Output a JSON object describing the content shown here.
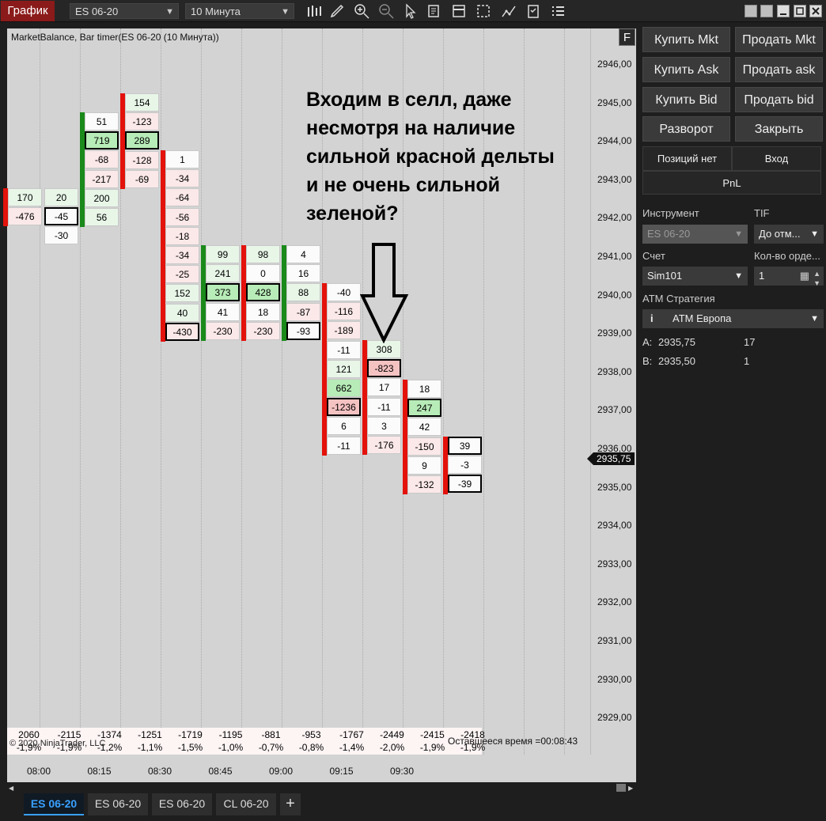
{
  "topbar": {
    "title": "График",
    "instrument": "ES 06-20",
    "interval": "10 Минута"
  },
  "chart": {
    "label": "MarketBalance, Bar timer(ES 06-20 (10 Минута))",
    "f_button": "F",
    "note": "Входим в селл, даже несмотря на наличие сильной красной дельты и не очень сильной зеленой?",
    "price_ticks": [
      "2946,00",
      "2945,00",
      "2944,00",
      "2943,00",
      "2942,00",
      "2941,00",
      "2940,00",
      "2939,00",
      "2938,00",
      "2937,00",
      "2936,00",
      "2935,00",
      "2934,00",
      "2933,00",
      "2932,00",
      "2931,00",
      "2930,00",
      "2929,00"
    ],
    "current_price": "2935,75",
    "time_ticks": [
      "08:00",
      "08:15",
      "08:30",
      "08:45",
      "09:00",
      "09:15",
      "09:30"
    ],
    "columns": [
      {
        "bar": "red",
        "cells": [
          {
            "v": "170",
            "c": "g"
          },
          {
            "v": "-476",
            "c": "r"
          }
        ]
      },
      {
        "bar": "",
        "cells": [
          {
            "v": "20",
            "c": "g"
          },
          {
            "v": "-45",
            "c": "b"
          },
          {
            "v": "-30",
            "c": ""
          }
        ]
      },
      {
        "bar": "green",
        "cells": [
          {
            "v": "51",
            "c": ""
          },
          {
            "v": "719",
            "c": "Gb"
          },
          {
            "v": "-68",
            "c": "r"
          },
          {
            "v": "-217",
            "c": "r"
          },
          {
            "v": "200",
            "c": "g"
          },
          {
            "v": "56",
            "c": "g"
          }
        ]
      },
      {
        "bar": "red",
        "cells": [
          {
            "v": "154",
            "c": "g"
          },
          {
            "v": "-123",
            "c": "r"
          },
          {
            "v": "289",
            "c": "Gb"
          },
          {
            "v": "-128",
            "c": "r"
          },
          {
            "v": "-69",
            "c": "r"
          }
        ]
      },
      {
        "bar": "red",
        "cells": [
          {
            "v": "1",
            "c": ""
          },
          {
            "v": "-34",
            "c": "r"
          },
          {
            "v": "-64",
            "c": "r"
          },
          {
            "v": "-56",
            "c": "r"
          },
          {
            "v": "-18",
            "c": "r"
          },
          {
            "v": "-34",
            "c": "r"
          },
          {
            "v": "-25",
            "c": "r"
          },
          {
            "v": "152",
            "c": "g"
          },
          {
            "v": "40",
            "c": "g"
          },
          {
            "v": "-430",
            "c": "rb"
          }
        ]
      },
      {
        "bar": "green",
        "cells": [
          {
            "v": "99",
            "c": "g"
          },
          {
            "v": "241",
            "c": "g"
          },
          {
            "v": "373",
            "c": "Gb"
          },
          {
            "v": "41",
            "c": ""
          },
          {
            "v": "-230",
            "c": "r"
          }
        ]
      },
      {
        "bar": "red",
        "cells": [
          {
            "v": "98",
            "c": "g"
          },
          {
            "v": "0",
            "c": ""
          },
          {
            "v": "428",
            "c": "Gb"
          },
          {
            "v": "18",
            "c": ""
          },
          {
            "v": "-230",
            "c": "r"
          }
        ]
      },
      {
        "bar": "green",
        "cells": [
          {
            "v": "4",
            "c": ""
          },
          {
            "v": "16",
            "c": ""
          },
          {
            "v": "88",
            "c": "g"
          },
          {
            "v": "-87",
            "c": "r"
          },
          {
            "v": "-93",
            "c": "b"
          }
        ]
      },
      {
        "bar": "red",
        "cells": [
          {
            "v": "-40",
            "c": ""
          },
          {
            "v": "-116",
            "c": "r"
          },
          {
            "v": "-189",
            "c": "r"
          },
          {
            "v": "-11",
            "c": ""
          },
          {
            "v": "121",
            "c": "g"
          },
          {
            "v": "662",
            "c": "G"
          },
          {
            "v": "-1236",
            "c": "Rb"
          },
          {
            "v": "6",
            "c": ""
          },
          {
            "v": "-11",
            "c": ""
          }
        ]
      },
      {
        "bar": "red",
        "cells": [
          {
            "v": "308",
            "c": "g"
          },
          {
            "v": "-823",
            "c": "Rb"
          },
          {
            "v": "17",
            "c": ""
          },
          {
            "v": "-11",
            "c": ""
          },
          {
            "v": "3",
            "c": ""
          },
          {
            "v": "-176",
            "c": "r"
          }
        ]
      },
      {
        "bar": "red",
        "cells": [
          {
            "v": "18",
            "c": ""
          },
          {
            "v": "247",
            "c": "Gb"
          },
          {
            "v": "42",
            "c": ""
          },
          {
            "v": "-150",
            "c": "r"
          },
          {
            "v": "9",
            "c": ""
          },
          {
            "v": "-132",
            "c": "r"
          }
        ]
      },
      {
        "bar": "red",
        "cells": [
          {
            "v": "39",
            "c": "b"
          },
          {
            "v": "-3",
            "c": ""
          },
          {
            "v": "-39",
            "c": "b"
          }
        ]
      }
    ],
    "stats_delta": [
      "2060",
      "-2115",
      "-1374",
      "-1251",
      "-1719",
      "-1195",
      "-881",
      "-953",
      "-1767",
      "-2449",
      "-2415",
      "-2418"
    ],
    "stats_pct": [
      "-1,9%",
      "-1,9%",
      "-1,2%",
      "-1,1%",
      "-1,5%",
      "-1,0%",
      "-0,7%",
      "-0,8%",
      "-1,4%",
      "-2,0%",
      "-1,9%",
      "-1,9%"
    ],
    "copyright": "© 2020 NinjaTrader, LLC",
    "timer": "Оставшееся время =00:08:43"
  },
  "tabs": [
    "ES 06-20",
    "ES 06-20",
    "ES 06-20",
    "CL 06-20"
  ],
  "add_tab": "+",
  "side": {
    "buy_mkt": "Купить Mkt",
    "sell_mkt": "Продать Mkt",
    "buy_ask": "Купить Ask",
    "sell_ask": "Продать ask",
    "buy_bid": "Купить Bid",
    "sell_bid": "Продать bid",
    "reverse": "Разворот",
    "close": "Закрыть",
    "no_positions": "Позиций нет",
    "entry": "Вход",
    "pnl": "PnL",
    "instrument_label": "Инструмент",
    "instrument_value": "ES 06-20",
    "tif_label": "TIF",
    "tif_value": "До отм...",
    "account_label": "Счет",
    "account_value": "Sim101",
    "qty_label": "Кол-во орде...",
    "qty_value": "1",
    "atm_label": "ATM Стратегия",
    "atm_value": "ATM Европа",
    "ask_label": "A:",
    "ask_price": "2935,75",
    "ask_size": "17",
    "bid_label": "B:",
    "bid_price": "2935,50",
    "bid_size": "1"
  }
}
